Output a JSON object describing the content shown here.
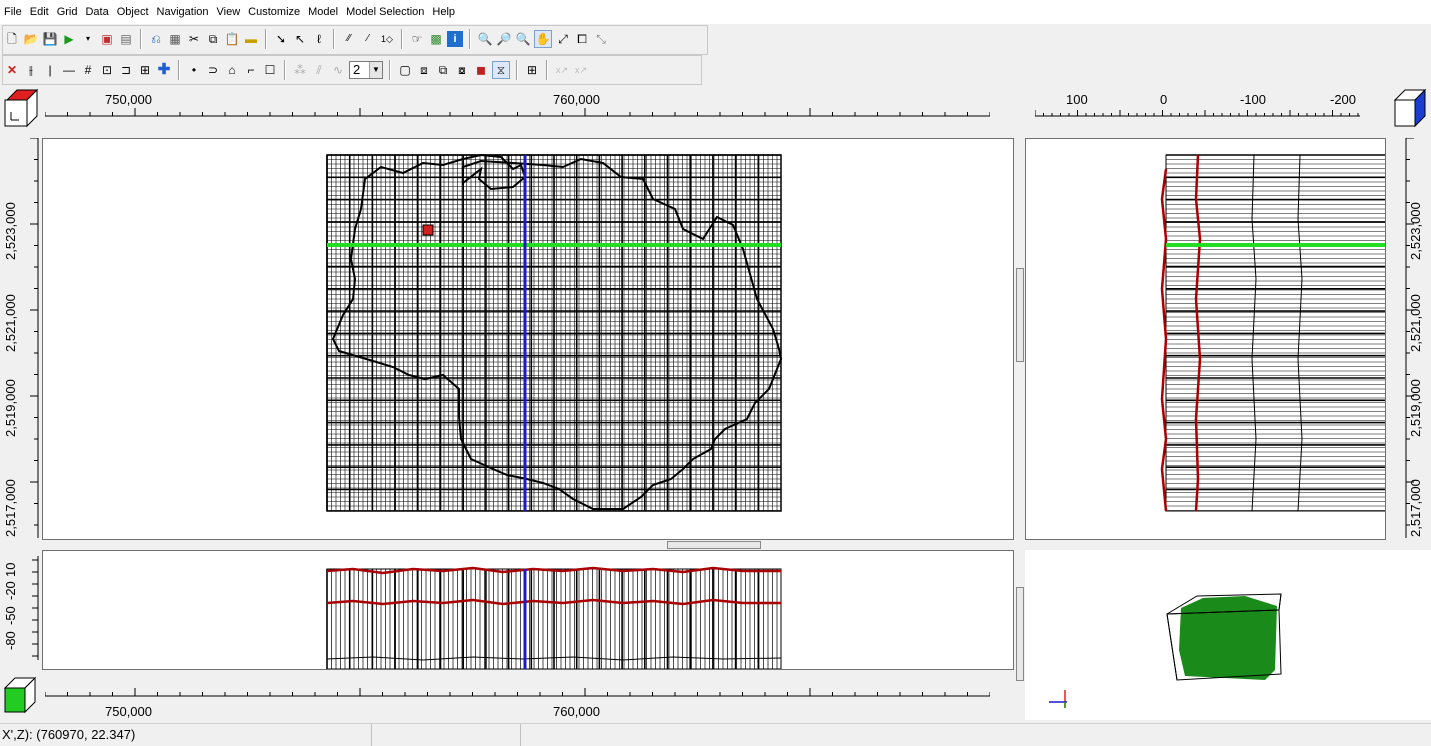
{
  "menu": [
    "File",
    "Edit",
    "Grid",
    "Data",
    "Object",
    "Navigation",
    "View",
    "Customize",
    "Model",
    "Model Selection",
    "Help"
  ],
  "toolbar": {
    "row1_icons": [
      "new-icon",
      "open-icon",
      "save-icon",
      "run-icon",
      "dropdown-icon",
      "import-icon",
      "export-icon",
      "undo-icon",
      "redo-icon",
      "cut-icon",
      "copy-icon",
      "paste-icon",
      "ruler-icon",
      "select-arrow-icon",
      "select-multi-icon",
      "lasso-icon",
      "split-icon",
      "merge-icon",
      "renumber-icon",
      "hand-pointer-icon",
      "grid-color-icon",
      "info-icon",
      "zoom-in-icon",
      "zoom-box-icon",
      "zoom-out-icon",
      "pan-icon",
      "zoom-extent-icon",
      "zoom-window-icon",
      "zoom-previous-icon"
    ],
    "row2_icons": [
      "delete-icon",
      "insert-column-icon",
      "line-icon",
      "horizontal-line-icon",
      "grid-refine-icon",
      "grid-box-icon",
      "aspect-icon",
      "mesh-icon",
      "add-icon",
      "point-icon",
      "arc-icon",
      "polygon-icon",
      "polyline-icon",
      "rectangle-icon",
      "edit-vertex-icon",
      "move-vertex-icon",
      "delete-vertex-icon",
      "layer-top-icon",
      "layer-cube-1-icon",
      "layer-cube-2-icon",
      "layer-cube-3-icon",
      "layer-cube-red-icon",
      "layer-cube-blue-icon",
      "table-icon",
      "axis-xy-icon",
      "axis-xz-icon"
    ],
    "layer_value": "2"
  },
  "top_ruler": {
    "labels": [
      "750,000",
      "760,000"
    ]
  },
  "right_ruler": {
    "labels": [
      "100",
      "0",
      "-100",
      "-200"
    ]
  },
  "left_ruler": {
    "labels": [
      "2,523,000",
      "2,521,000",
      "2,519,000",
      "2,517,000"
    ]
  },
  "right_vruler": {
    "labels": [
      "2,523,000",
      "2,521,000",
      "2,519,000",
      "2,517,000"
    ]
  },
  "bottom_left_vruler": {
    "labels": [
      "10",
      "-20",
      "-50",
      "-80"
    ]
  },
  "bottom_ruler": {
    "labels": [
      "750,000",
      "760,000"
    ]
  },
  "status": {
    "coords": "X',Z): (760970, 22.347)",
    "cell2": "",
    "cell3": ""
  },
  "colors": {
    "grid": "#000000",
    "boundary": "#000000",
    "row_highlight": "#22dd22",
    "col_highlight": "#1a1acc",
    "top_layer": "#aa0000",
    "model3d": "#1a8a1a"
  }
}
